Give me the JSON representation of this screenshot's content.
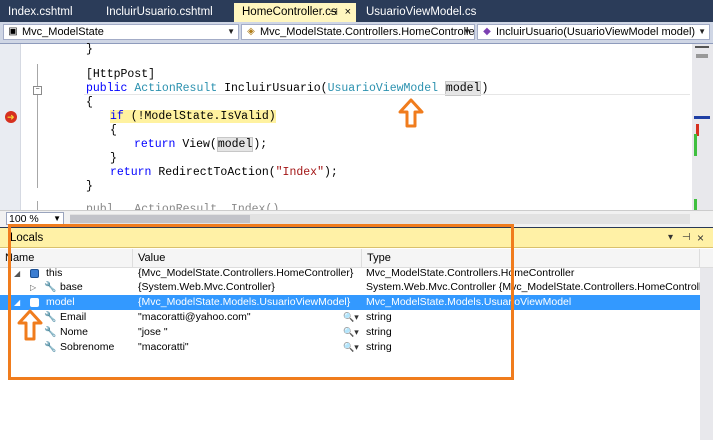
{
  "tabs": [
    {
      "label": "Index.cshtml"
    },
    {
      "label": "IncluirUsuario.cshtml"
    },
    {
      "label": "HomeController.cs"
    },
    {
      "label": "UsuarioViewModel.cs"
    }
  ],
  "tab_pin_icon": "⊣",
  "tab_close_icon": "×",
  "navbar": {
    "project": "Mvc_ModelState",
    "type": "Mvc_ModelState.Controllers.HomeController",
    "member": "IncluirUsuario(UsuarioViewModel model)"
  },
  "code": {
    "line1": "}",
    "attr": "[HttpPost]",
    "sig_public": "public",
    "sig_ret": "ActionResult",
    "sig_name": "IncluirUsuario(",
    "sig_type": "UsuarioViewModel",
    "sig_param": "model",
    "sig_close": ")",
    "open1": "{",
    "if_kw": "if",
    "if_rest": " (!ModelState.IsValid)",
    "open2": "{",
    "ret_kw": "return",
    "ret_view": " View(",
    "ret_model": "model",
    "ret_end": ");",
    "close2": "}",
    "ret2_kw": "return",
    "ret2_mid": " RedirectToAction(",
    "ret2_str": "\"Index\"",
    "ret2_end": ");",
    "close1": "}",
    "partial": "publ...ActionResult..Index()"
  },
  "zoom": "100 %",
  "locals": {
    "title": "Locals",
    "pin_icon": "⊣",
    "dropdown_icon": "▾",
    "close_icon": "×",
    "columns": [
      "Name",
      "Value",
      "Type"
    ],
    "rows": [
      {
        "name": "this",
        "value": "{Mvc_ModelState.Controllers.HomeController}",
        "type": "Mvc_ModelState.Controllers.HomeController"
      },
      {
        "name": "base",
        "value": "{System.Web.Mvc.Controller}",
        "type": "System.Web.Mvc.Controller {Mvc_ModelState.Controllers.HomeController}"
      },
      {
        "name": "model",
        "value": "{Mvc_ModelState.Models.UsuarioViewModel}",
        "type": "Mvc_ModelState.Models.UsuarioViewModel"
      },
      {
        "name": "Email",
        "value": "\"macoratti@yahoo.com\"",
        "type": "string"
      },
      {
        "name": "Nome",
        "value": "\"jose \"",
        "type": "string"
      },
      {
        "name": "Sobrenome",
        "value": "\"macoratti\"",
        "type": "string"
      }
    ]
  },
  "colors": {
    "annotation": "#f07c1d",
    "selection": "#3399ff",
    "tab_active": "#fff6bf"
  }
}
